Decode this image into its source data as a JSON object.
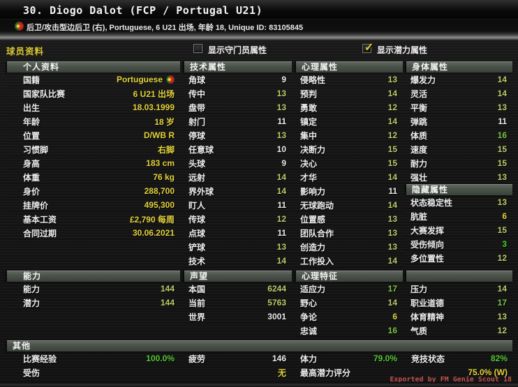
{
  "colors": {
    "yellow": "#e3d23b",
    "olive": "#bccb69",
    "green": "#7cc244",
    "bright": "#45d822",
    "white": "#eaeaea",
    "pct": "#55c636",
    "tab": "#ddc832",
    "export": "#c05050",
    "header_bar": "#4a524a"
  },
  "window": {
    "title": "30. Diogo Dalot (FCP / Portugal U21)",
    "subtitle": "后卫/攻击型边后卫 (右), Portuguese, 6 U21 出场, 年龄 18, Unique ID: 83105845"
  },
  "toolbar": {
    "tab": "球员资料",
    "checkbox_gk": {
      "label": "显示守门员属性",
      "glyph": ""
    },
    "checkbox_potential": {
      "label": "显示潜力属性",
      "glyph": "✓"
    }
  },
  "sections": {
    "personal": {
      "title": "个人资料",
      "rows": [
        {
          "label": "国籍",
          "value": "Portuguese",
          "vc": "yellow",
          "flag": "true"
        },
        {
          "label": "国家队比赛",
          "value": "6 U21 出场",
          "vc": "yellow"
        },
        {
          "label": "出生",
          "value": "18.03.1999",
          "vc": "yellow"
        },
        {
          "label": "年龄",
          "value": "18 岁",
          "vc": "yellow"
        },
        {
          "label": "位置",
          "value": "D/WB R",
          "vc": "yellow"
        },
        {
          "label": "习惯脚",
          "value": "右脚",
          "vc": "yellow"
        },
        {
          "label": "身高",
          "value": "183 cm",
          "vc": "yellow"
        },
        {
          "label": "体重",
          "value": "76 kg",
          "vc": "yellow"
        },
        {
          "label": "身价",
          "value": "288,700",
          "vc": "yellow"
        },
        {
          "label": "挂牌价",
          "value": "495,300",
          "vc": "yellow"
        },
        {
          "label": "基本工资",
          "value": "£2,790 每周",
          "vc": "yellow"
        },
        {
          "label": "合同过期",
          "value": "30.06.2021",
          "vc": "yellow"
        }
      ]
    },
    "technical": {
      "title": "技术属性",
      "rows": [
        {
          "label": "角球",
          "value": "9",
          "vc": "white"
        },
        {
          "label": "传中",
          "value": "13",
          "vc": "olive"
        },
        {
          "label": "盘带",
          "value": "13",
          "vc": "olive"
        },
        {
          "label": "射门",
          "value": "11",
          "vc": "white"
        },
        {
          "label": "停球",
          "value": "13",
          "vc": "olive"
        },
        {
          "label": "任意球",
          "value": "10",
          "vc": "white"
        },
        {
          "label": "头球",
          "value": "9",
          "vc": "white"
        },
        {
          "label": "远射",
          "value": "14",
          "vc": "olive"
        },
        {
          "label": "界外球",
          "value": "14",
          "vc": "olive"
        },
        {
          "label": "盯人",
          "value": "11",
          "vc": "white"
        },
        {
          "label": "传球",
          "value": "12",
          "vc": "olive"
        },
        {
          "label": "点球",
          "value": "11",
          "vc": "white"
        },
        {
          "label": "铲球",
          "value": "13",
          "vc": "olive"
        },
        {
          "label": "技术",
          "value": "14",
          "vc": "olive"
        }
      ]
    },
    "mental": {
      "title": "心理属性",
      "rows": [
        {
          "label": "侵略性",
          "value": "13",
          "vc": "olive"
        },
        {
          "label": "预判",
          "value": "14",
          "vc": "olive"
        },
        {
          "label": "勇敢",
          "value": "12",
          "vc": "olive"
        },
        {
          "label": "镇定",
          "value": "14",
          "vc": "olive"
        },
        {
          "label": "集中",
          "value": "12",
          "vc": "olive"
        },
        {
          "label": "决断力",
          "value": "15",
          "vc": "olive"
        },
        {
          "label": "决心",
          "value": "15",
          "vc": "olive"
        },
        {
          "label": "才华",
          "value": "14",
          "vc": "olive"
        },
        {
          "label": "影响力",
          "value": "11",
          "vc": "white"
        },
        {
          "label": "无球跑动",
          "value": "14",
          "vc": "olive"
        },
        {
          "label": "位置感",
          "value": "13",
          "vc": "olive"
        },
        {
          "label": "团队合作",
          "value": "13",
          "vc": "olive"
        },
        {
          "label": "创造力",
          "value": "13",
          "vc": "olive"
        },
        {
          "label": "工作投入",
          "value": "14",
          "vc": "olive"
        }
      ]
    },
    "physical": {
      "title": "身体属性",
      "rows": [
        {
          "label": "爆发力",
          "value": "14",
          "vc": "olive"
        },
        {
          "label": "灵活",
          "value": "14",
          "vc": "olive"
        },
        {
          "label": "平衡",
          "value": "13",
          "vc": "olive"
        },
        {
          "label": "弹跳",
          "value": "11",
          "vc": "white"
        },
        {
          "label": "体质",
          "value": "16",
          "vc": "green"
        },
        {
          "label": "速度",
          "value": "15",
          "vc": "olive"
        },
        {
          "label": "耐力",
          "value": "15",
          "vc": "olive"
        },
        {
          "label": "强壮",
          "value": "13",
          "vc": "olive"
        }
      ]
    },
    "hidden": {
      "title": "隐藏属性",
      "rows": [
        {
          "label": "状态稳定性",
          "value": "13",
          "vc": "olive"
        },
        {
          "label": "肮脏",
          "value": "6",
          "vc": "yellow"
        },
        {
          "label": "大赛发挥",
          "value": "15",
          "vc": "olive"
        },
        {
          "label": "受伤倾向",
          "value": "3",
          "vc": "bright"
        },
        {
          "label": "多位置性",
          "value": "12",
          "vc": "olive"
        }
      ]
    },
    "physical_extra": {
      "title": "",
      "rows": [
        {
          "label": "压力",
          "value": "14",
          "vc": "olive"
        },
        {
          "label": "职业道德",
          "value": "17",
          "vc": "green"
        },
        {
          "label": "体育精神",
          "value": "13",
          "vc": "olive"
        },
        {
          "label": "气质",
          "value": "12",
          "vc": "olive"
        }
      ]
    },
    "ability": {
      "title": "能力",
      "rows": [
        {
          "label": "能力",
          "value": "144",
          "vc": "olive"
        },
        {
          "label": "潜力",
          "value": "144",
          "vc": "olive"
        }
      ]
    },
    "reputation": {
      "title": "声望",
      "rows": [
        {
          "label": "本国",
          "value": "6244",
          "vc": "olive"
        },
        {
          "label": "当前",
          "value": "5763",
          "vc": "olive"
        },
        {
          "label": "世界",
          "value": "3001",
          "vc": "white"
        }
      ]
    },
    "personality": {
      "title": "心理特征",
      "rows": [
        {
          "label": "适应力",
          "value": "17",
          "vc": "green"
        },
        {
          "label": "野心",
          "value": "14",
          "vc": "olive"
        },
        {
          "label": "争论",
          "value": "6",
          "vc": "yellow"
        },
        {
          "label": "忠诚",
          "value": "16",
          "vc": "green"
        }
      ]
    },
    "other": {
      "title": "其他",
      "cells": [
        {
          "label": "比赛经验",
          "value": "100.0%",
          "vc": "pct"
        },
        {
          "label": "疲劳",
          "value": "146",
          "vc": "white"
        },
        {
          "label": "体力",
          "value": "79.0%",
          "vc": "pct"
        },
        {
          "label": "竞技状态",
          "value": "82%",
          "vc": "pct"
        },
        {
          "label": "受伤",
          "value": "",
          "vc": ""
        },
        {
          "label": "",
          "value": "无",
          "vc": "yellow"
        },
        {
          "label": "最高潜力评分",
          "value": "",
          "vc": ""
        },
        {
          "label": "",
          "value": "75.0% (W)",
          "vc": "yellow"
        }
      ]
    }
  },
  "footer": {
    "export_note": "Exported by FM Genie Scout 18"
  }
}
